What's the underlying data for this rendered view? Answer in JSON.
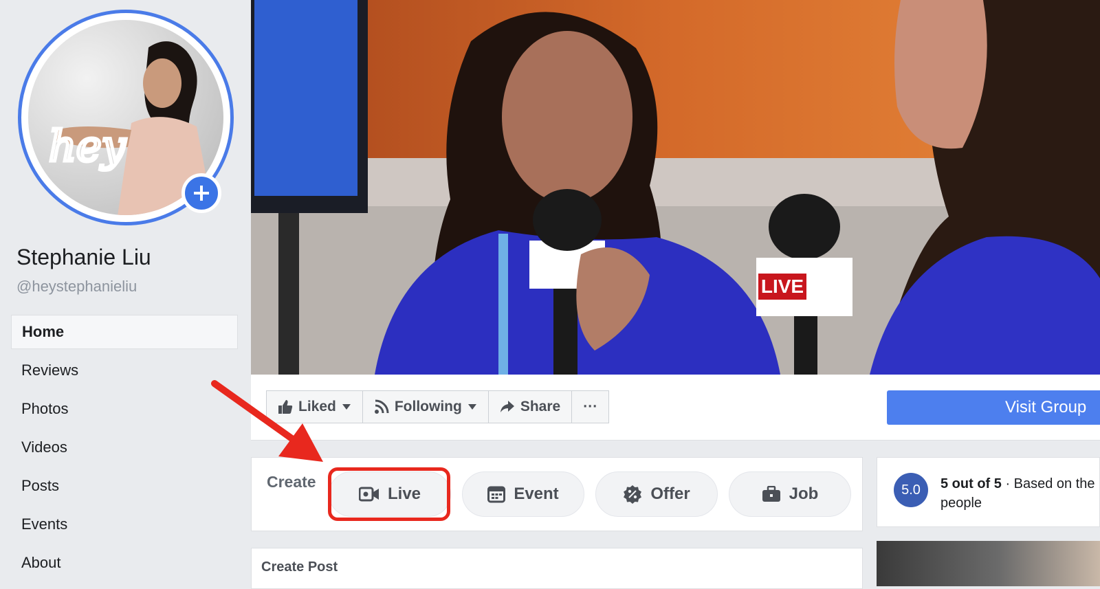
{
  "page": {
    "name": "Stephanie Liu",
    "handle": "@heystephanieliu"
  },
  "avatar": {
    "script_text": "hey"
  },
  "nav": {
    "items": [
      {
        "label": "Home",
        "active": true
      },
      {
        "label": "Reviews"
      },
      {
        "label": "Photos"
      },
      {
        "label": "Videos"
      },
      {
        "label": "Posts"
      },
      {
        "label": "Events"
      },
      {
        "label": "About"
      }
    ]
  },
  "cover": {
    "mic_flag_text": "LIVE"
  },
  "actions": {
    "liked": "Liked",
    "following": "Following",
    "share": "Share",
    "more": "···",
    "visit_group": "Visit Group"
  },
  "create": {
    "label": "Create",
    "live": "Live",
    "event": "Event",
    "offer": "Offer",
    "job": "Job"
  },
  "rating": {
    "score": "5.0",
    "headline": "5 out of 5",
    "rest": " · Based on the",
    "line2": "people"
  },
  "post": {
    "label": "Create Post"
  },
  "colors": {
    "accent_blue": "#4d7fee",
    "highlight_red": "#e8281e",
    "avatar_ring": "#4a7be8"
  }
}
